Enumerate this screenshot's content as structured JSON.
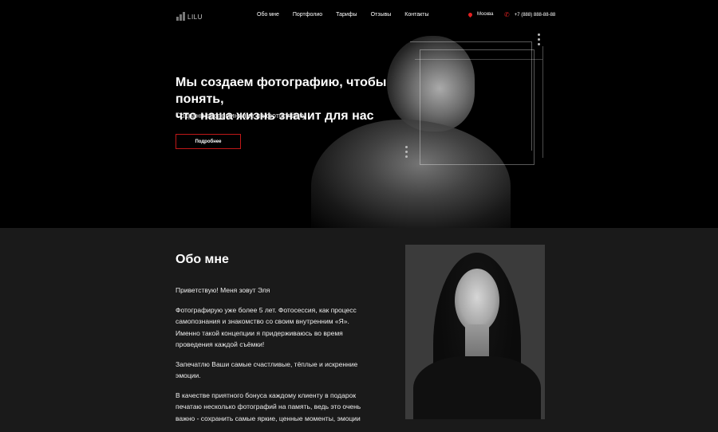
{
  "header": {
    "logo_text": "LILU",
    "nav": [
      "Обо мне",
      "Портфолио",
      "Тарифы",
      "Отзывы",
      "Контакты"
    ],
    "city": "Москва",
    "phone": "+7 (888) 888-88-88"
  },
  "hero": {
    "title_line1": "Мы создаем фотографию, чтобы понять,",
    "title_line2": "что наша жизнь значит для нас",
    "subtitle": "Сохрани воспоминание на фотоплёнку",
    "button_label": "Подробнее"
  },
  "about": {
    "title": "Обо мне",
    "paragraphs": [
      "Приветствую! Меня зовут Эля",
      "Фотографирую уже более 5 лет. Фотосессия, как процесс самопознания и знакомство со своим внутренним «Я». Именно такой концепции я придерживаюсь во время проведения каждой съёмки!",
      "Запечатлю Ваши самые счастливые, тёплые и искренние эмоции.",
      "В качестве приятного бонуса каждому клиенту в подарок печатаю несколько фотографий на память, ведь это очень важно - сохранить самые яркие, ценные моменты, эмоции"
    ]
  },
  "icons": {
    "location": "map-pin-icon",
    "phone": "phone-icon"
  },
  "colors": {
    "accent": "#e32020",
    "hero_bg": "#000000",
    "section_bg": "#1a1a1a"
  }
}
